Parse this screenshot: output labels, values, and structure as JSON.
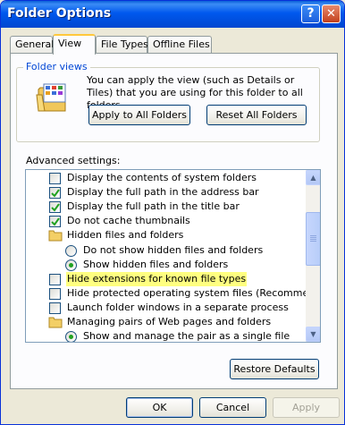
{
  "window": {
    "title": "Folder Options",
    "help_label": "?",
    "close_label": "✕"
  },
  "tabs": [
    {
      "label": "General",
      "active": false
    },
    {
      "label": "View",
      "active": true
    },
    {
      "label": "File Types",
      "active": false
    },
    {
      "label": "Offline Files",
      "active": false
    }
  ],
  "folder_views": {
    "legend": "Folder views",
    "description": "You can apply the view (such as Details or Tiles) that you are using for this folder to all folders.",
    "apply_all_label": "Apply to All Folders",
    "reset_all_label": "Reset All Folders"
  },
  "advanced": {
    "label": "Advanced settings:",
    "items": [
      {
        "kind": "checkbox",
        "indent": 0,
        "checked": false,
        "label": "Display the contents of system folders"
      },
      {
        "kind": "checkbox",
        "indent": 0,
        "checked": true,
        "label": "Display the full path in the address bar"
      },
      {
        "kind": "checkbox",
        "indent": 0,
        "checked": true,
        "label": "Display the full path in the title bar"
      },
      {
        "kind": "checkbox",
        "indent": 0,
        "checked": true,
        "label": "Do not cache thumbnails"
      },
      {
        "kind": "folder",
        "indent": 0,
        "label": "Hidden files and folders"
      },
      {
        "kind": "radio",
        "indent": 1,
        "checked": false,
        "label": "Do not show hidden files and folders"
      },
      {
        "kind": "radio",
        "indent": 1,
        "checked": true,
        "label": "Show hidden files and folders"
      },
      {
        "kind": "checkbox",
        "indent": 0,
        "checked": false,
        "highlighted": true,
        "label": "Hide extensions for known file types"
      },
      {
        "kind": "checkbox",
        "indent": 0,
        "checked": false,
        "label": "Hide protected operating system files (Recommended)"
      },
      {
        "kind": "checkbox",
        "indent": 0,
        "checked": false,
        "label": "Launch folder windows in a separate process"
      },
      {
        "kind": "folder",
        "indent": 0,
        "label": "Managing pairs of Web pages and folders"
      },
      {
        "kind": "radio",
        "indent": 1,
        "checked": true,
        "label": "Show and manage the pair as a single file"
      }
    ]
  },
  "buttons": {
    "restore_defaults": "Restore Defaults",
    "ok": "OK",
    "cancel": "Cancel",
    "apply": "Apply"
  },
  "colors": {
    "title_bar": "#0058ee",
    "group_legend": "#0046d5",
    "highlight": "#ffff80",
    "check_mark": "#21a121"
  }
}
